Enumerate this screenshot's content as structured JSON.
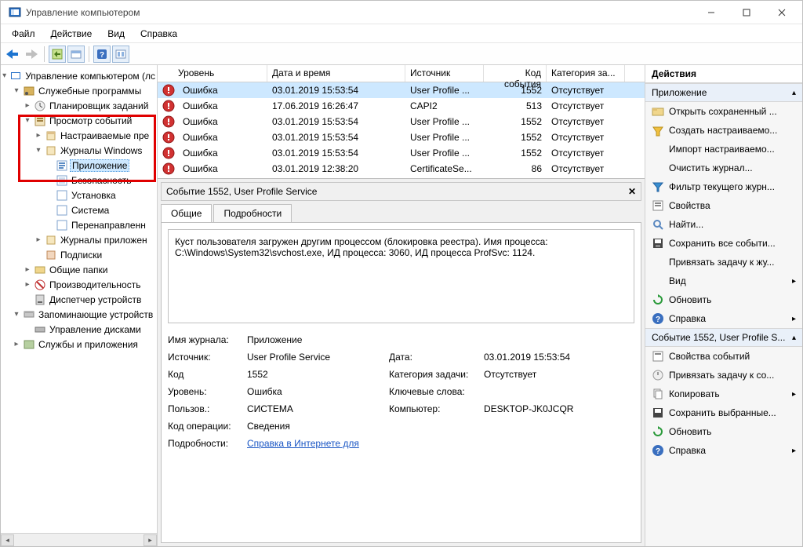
{
  "titlebar": {
    "title": "Управление компьютером"
  },
  "menubar": {
    "file": "Файл",
    "action": "Действие",
    "view": "Вид",
    "help": "Справка"
  },
  "tree": {
    "root": "Управление компьютером (лс",
    "utils": "Служебные программы",
    "scheduler": "Планировщик заданий",
    "eventviewer": "Просмотр событий",
    "customviews": "Настраиваемые пре",
    "winlogs": "Журналы Windows",
    "application": "Приложение",
    "security": "Безопасность",
    "setup": "Установка",
    "system": "Система",
    "forwarded": "Перенаправленн",
    "applogs": "Журналы приложен",
    "subscriptions": "Подписки",
    "shared": "Общие папки",
    "perf": "Производительность",
    "devmgr": "Диспетчер устройств",
    "storage": "Запоминающие устройств",
    "diskmgmt": "Управление дисками",
    "services": "Службы и приложения"
  },
  "list": {
    "headers": {
      "level": "Уровень",
      "date": "Дата и время",
      "source": "Источник",
      "eventid": "Код события",
      "category": "Категория за..."
    },
    "rows": [
      {
        "level": "Ошибка",
        "date": "03.01.2019 15:53:54",
        "source": "User Profile ...",
        "id": "1552",
        "cat": "Отсутствует",
        "sel": true
      },
      {
        "level": "Ошибка",
        "date": "17.06.2019 16:26:47",
        "source": "CAPI2",
        "id": "513",
        "cat": "Отсутствует",
        "sel": false
      },
      {
        "level": "Ошибка",
        "date": "03.01.2019 15:53:54",
        "source": "User Profile ...",
        "id": "1552",
        "cat": "Отсутствует",
        "sel": false
      },
      {
        "level": "Ошибка",
        "date": "03.01.2019 15:53:54",
        "source": "User Profile ...",
        "id": "1552",
        "cat": "Отсутствует",
        "sel": false
      },
      {
        "level": "Ошибка",
        "date": "03.01.2019 15:53:54",
        "source": "User Profile ...",
        "id": "1552",
        "cat": "Отсутствует",
        "sel": false
      },
      {
        "level": "Ошибка",
        "date": "03.01.2019 12:38:20",
        "source": "CertificateSe...",
        "id": "86",
        "cat": "Отсутствует",
        "sel": false
      }
    ]
  },
  "detail": {
    "title": "Событие 1552, User Profile Service",
    "tabs": {
      "general": "Общие",
      "details": "Подробности"
    },
    "description": "Куст пользователя загружен другим процессом (блокировка реестра). Имя процесса: C:\\Windows\\System32\\svchost.exe, ИД процесса: 3060, ИД процесса ProfSvc: 1124.",
    "labels": {
      "logname": "Имя журнала:",
      "source": "Источник:",
      "eventid": "Код",
      "level": "Уровень:",
      "user": "Пользов.:",
      "opcode": "Код операции:",
      "more": "Подробности:",
      "date": "Дата:",
      "category": "Категория задачи:",
      "keywords": "Ключевые слова:",
      "computer": "Компьютер:"
    },
    "values": {
      "logname": "Приложение",
      "source": "User Profile Service",
      "eventid": "1552",
      "level": "Ошибка",
      "user": "СИСТЕМА",
      "opcode": "Сведения",
      "date": "03.01.2019 15:53:54",
      "category": "Отсутствует",
      "keywords": "",
      "computer": "DESKTOP-JK0JCQR",
      "morelink": "Справка в Интернете для"
    }
  },
  "actions": {
    "header": "Действия",
    "group1": "Приложение",
    "open": "Открыть сохраненный ...",
    "create": "Создать настраиваемо...",
    "import": "Импорт настраиваемо...",
    "clear": "Очистить журнал...",
    "filter": "Фильтр текущего журн...",
    "props": "Свойства",
    "find": "Найти...",
    "saveall": "Сохранить все событи...",
    "attach": "Привязать задачу к жу...",
    "view": "Вид",
    "refresh": "Обновить",
    "help": "Справка",
    "group2": "Событие 1552, User Profile S...",
    "eprops": "Свойства событий",
    "eattach": "Привязать задачу к со...",
    "copy": "Копировать",
    "savesel": "Сохранить выбранные...",
    "refresh2": "Обновить",
    "help2": "Справка"
  }
}
